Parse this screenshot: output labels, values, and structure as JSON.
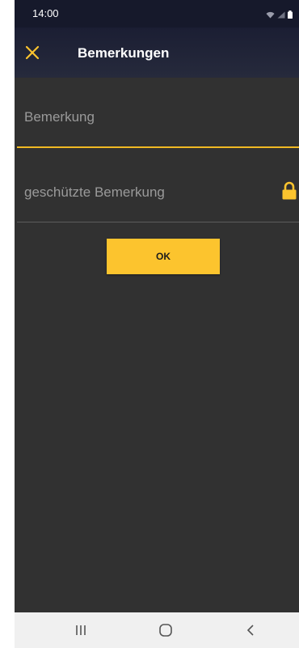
{
  "status_bar": {
    "time": "14:00",
    "icons": [
      "wifi-icon",
      "signal-icon",
      "battery-icon"
    ]
  },
  "app_bar": {
    "close_icon": "close-icon",
    "title": "Bemerkungen"
  },
  "form": {
    "remark_placeholder": "Bemerkung",
    "remark_value": "",
    "protected_remark_placeholder": "geschützte Bemerkung",
    "protected_remark_value": "",
    "protected_icon": "lock-icon",
    "ok_label": "OK"
  },
  "nav_bar": {
    "icons": [
      "recent-apps-icon",
      "home-icon",
      "back-icon"
    ]
  },
  "colors": {
    "accent": "#fcc42e",
    "header": "#1b1e33",
    "background": "#313131",
    "field_active_underline": "#f0b923",
    "field_inactive_underline": "#5c5c5c",
    "placeholder": "#9a9a9a",
    "nav_background": "#f0f0f0"
  }
}
